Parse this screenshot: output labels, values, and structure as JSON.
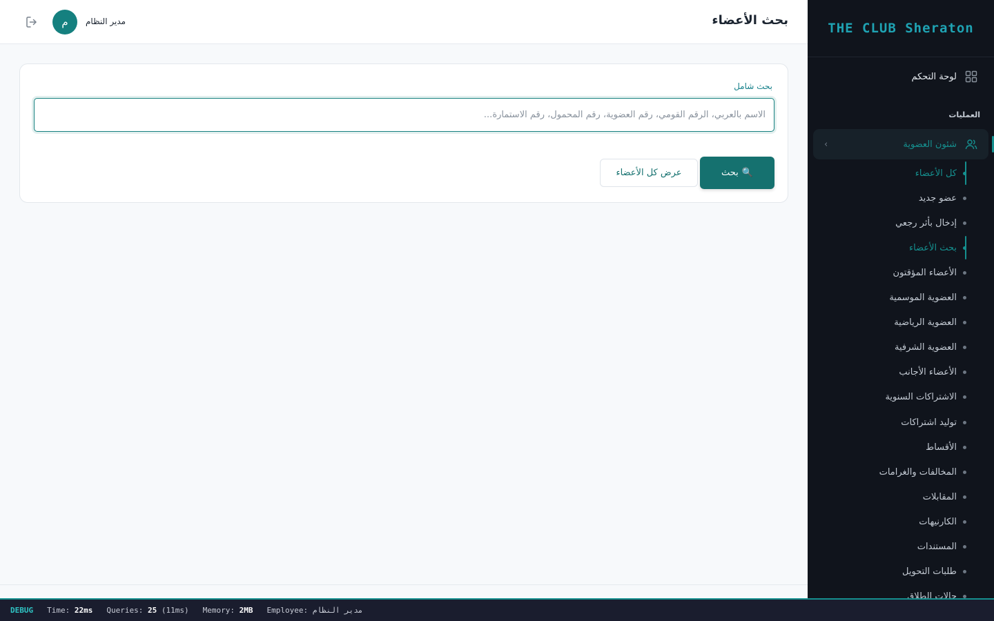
{
  "brand": {
    "name": "THE CLUB Sheraton"
  },
  "sidebar": {
    "dashboard_label": "لوحة التحكم",
    "section_title": "العمليات",
    "group_label": "شئون العضوية",
    "items": [
      {
        "label": "كل الأعضاء",
        "active": true
      },
      {
        "label": "عضو جديد",
        "active": false
      },
      {
        "label": "إدخال بأثر رجعي",
        "active": false
      },
      {
        "label": "بحث الأعضاء",
        "active": true
      },
      {
        "label": "الأعضاء المؤقتون",
        "active": false
      },
      {
        "label": "العضوية الموسمية",
        "active": false
      },
      {
        "label": "العضوية الرياضية",
        "active": false
      },
      {
        "label": "العضوية الشرفية",
        "active": false
      },
      {
        "label": "الأعضاء الأجانب",
        "active": false
      },
      {
        "label": "الاشتراكات السنوية",
        "active": false
      },
      {
        "label": "توليد اشتراكات",
        "active": false
      },
      {
        "label": "الأقساط",
        "active": false
      },
      {
        "label": "المخالفات والغرامات",
        "active": false
      },
      {
        "label": "المقابلات",
        "active": false
      },
      {
        "label": "الكارنيهات",
        "active": false
      },
      {
        "label": "المستندات",
        "active": false
      },
      {
        "label": "طلبات التحويل",
        "active": false
      },
      {
        "label": "حالات الطلاق",
        "active": false
      }
    ]
  },
  "header": {
    "title": "بحث الأعضاء",
    "user_name": "مدير النظام",
    "avatar_letter": "م"
  },
  "search": {
    "label": "بحث شامل",
    "value": "",
    "placeholder": "الاسم بالعربي، الرقم القومي، رقم العضوية، رقم المحمول، رقم الاستمارة...",
    "search_button": "بحث",
    "search_icon": "🔍",
    "show_all_button": "عرض كل الأعضاء"
  },
  "debug": {
    "tag": "DEBUG",
    "time_label": "Time:",
    "time_value": "22ms",
    "queries_label": "Queries:",
    "queries_value": "25",
    "queries_extra": "(11ms)",
    "memory_label": "Memory:",
    "memory_value": "2MB",
    "employee_label": "Employee:",
    "employee_value": "مدير النظام"
  },
  "colors": {
    "accent": "#15807f",
    "sidebar_bg": "#10141c",
    "brand": "#1fa3b3"
  }
}
